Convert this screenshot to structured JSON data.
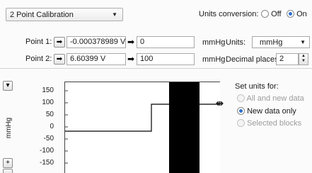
{
  "top": {
    "calibration_mode": "2 Point Calibration",
    "units_conversion_label": "Units conversion:",
    "off_label": "Off",
    "on_label": "On"
  },
  "point1": {
    "label": "Point 1:",
    "raw": "-0.000378989 V",
    "value": "0",
    "unit": "mmHg"
  },
  "point2": {
    "label": "Point 2:",
    "raw": "6.60399 V",
    "value": "100",
    "unit": "mmHg"
  },
  "units": {
    "label": "Units:",
    "selected": "mmHg"
  },
  "decimal": {
    "label": "Decimal places:",
    "value": "2"
  },
  "chart": {
    "ylabel": "mmHg",
    "ticks": [
      "150",
      "100",
      "50",
      "0",
      "-50",
      "-100",
      "-150"
    ]
  },
  "set_units": {
    "title": "Set units for:",
    "options": [
      "All and new data",
      "New data only",
      "Selected blocks"
    ]
  },
  "chart_data": {
    "type": "line",
    "ylabel": "mmHg",
    "yticks": [
      150,
      100,
      50,
      0,
      -50,
      -100,
      -150
    ],
    "series": [
      {
        "values": [
          0,
          0,
          100,
          100
        ]
      }
    ]
  }
}
